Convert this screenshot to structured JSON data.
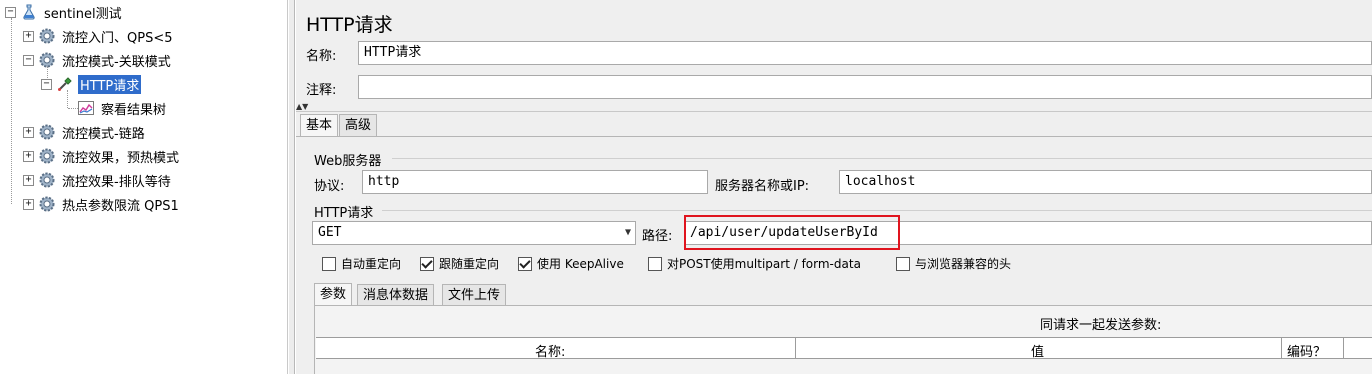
{
  "tree": {
    "root": "sentinel测试",
    "items": [
      {
        "label": "流控入门、QPS<5"
      },
      {
        "label": "流控模式-关联模式"
      },
      {
        "label": "HTTP请求"
      },
      {
        "label": "察看结果树"
      },
      {
        "label": "流控模式-链路"
      },
      {
        "label": "流控效果，预热模式"
      },
      {
        "label": "流控效果-排队等待"
      },
      {
        "label": "热点参数限流 QPS1"
      }
    ]
  },
  "panel": {
    "title": "HTTP请求",
    "name_label": "名称:",
    "name_value": "HTTP请求",
    "comment_label": "注释:",
    "comment_value": "",
    "tabs": [
      "基本",
      "高级"
    ],
    "web_server_group": "Web服务器",
    "protocol_label": "协议:",
    "protocol_value": "http",
    "server_label": "服务器名称或IP:",
    "server_value": "localhost",
    "http_request_group": "HTTP请求",
    "method_value": "GET",
    "path_label": "路径:",
    "path_value": "/api/user/updateUserById",
    "options": [
      {
        "label": "自动重定向",
        "checked": false
      },
      {
        "label": "跟随重定向",
        "checked": true
      },
      {
        "label": "使用 KeepAlive",
        "checked": true
      },
      {
        "label": "对POST使用multipart / form-data",
        "checked": false
      },
      {
        "label": "与浏览器兼容的头",
        "checked": false
      }
    ],
    "sub_tabs": [
      "参数",
      "消息体数据",
      "文件上传"
    ],
    "params_caption": "同请求一起发送参数:",
    "columns": [
      "名称:",
      "值",
      "编码？"
    ]
  },
  "colors": {
    "selection": "#2f6ccb",
    "highlight_border": "#e0141e"
  }
}
